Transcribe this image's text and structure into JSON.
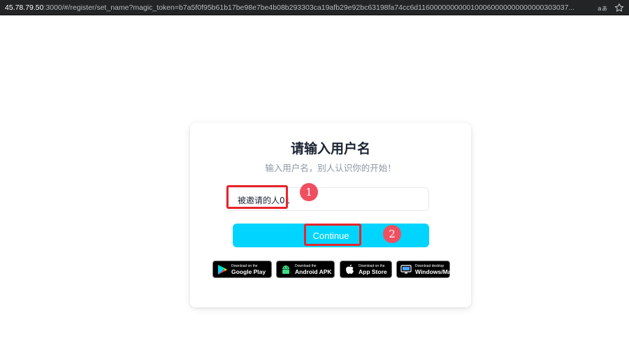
{
  "browser": {
    "url_host": "45.78.79.50",
    "url_rest": ":3000/#/register/set_name?magic_token=b7a5f0f95b61b17be98e7be4b08b293303ca19afb29e92bc63198fa74cc6d1160000000000100060000000000000303037..."
  },
  "card": {
    "title": "请输入用户名",
    "subtitle": "输入用户名，别人认识你的开始！",
    "name_input_value": "被邀请的人01",
    "continue_label": "Continue"
  },
  "stores": [
    {
      "small": "Download on the",
      "big": "Google Play",
      "icon": "google-play-icon"
    },
    {
      "small": "Download the",
      "big": "Android APK",
      "icon": "android-icon"
    },
    {
      "small": "Download on the",
      "big": "App Store",
      "icon": "apple-icon"
    },
    {
      "small": "Download desktop",
      "big": "Windows/Mac",
      "icon": "desktop-icon"
    }
  ],
  "annotations": {
    "marker_1": "1",
    "marker_2": "2"
  },
  "colors": {
    "button": "#00d4ff",
    "highlight": "#e8242b",
    "marker": "#ef4f5e"
  }
}
